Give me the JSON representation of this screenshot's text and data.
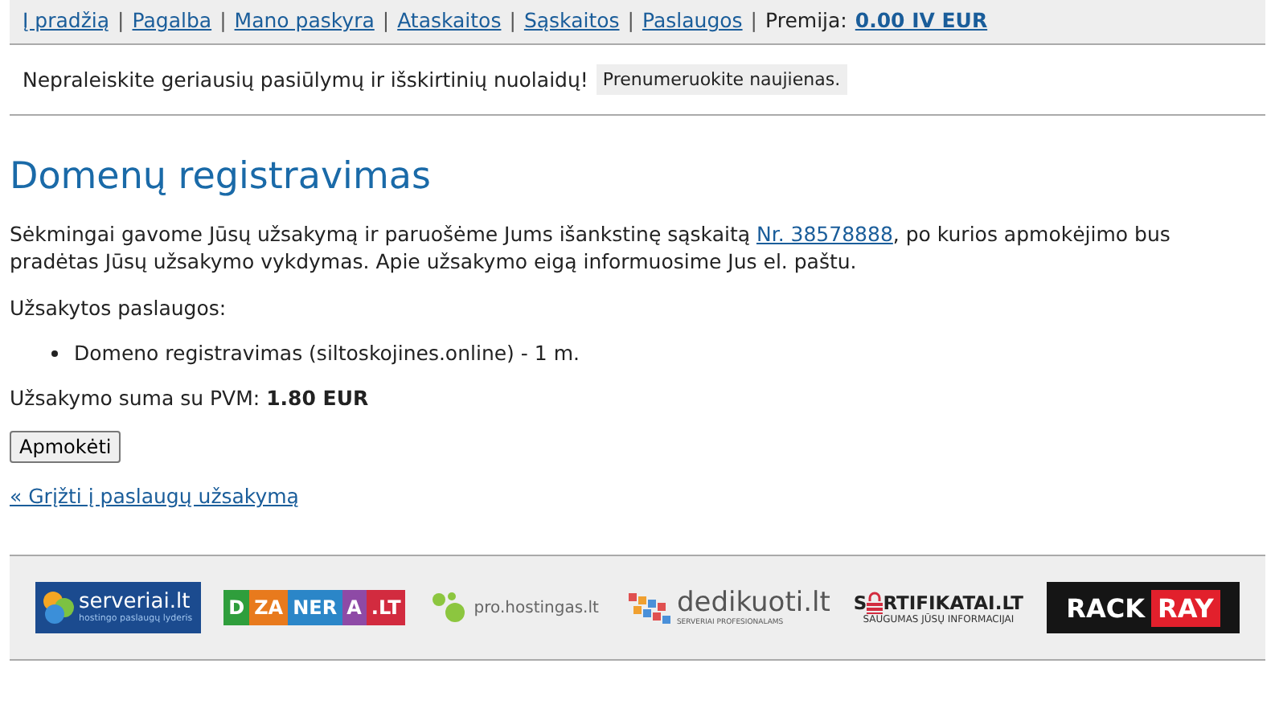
{
  "nav": {
    "links": [
      {
        "label": "Į pradžią"
      },
      {
        "label": "Pagalba"
      },
      {
        "label": "Mano paskyra"
      },
      {
        "label": "Ataskaitos"
      },
      {
        "label": "Sąskaitos"
      },
      {
        "label": "Paslaugos"
      }
    ],
    "separator": "|",
    "bonus_label": "Premija:",
    "bonus_value": "0.00 IV EUR"
  },
  "promo": {
    "text": "Nepraleiskite geriausių pasiūlymų ir išskirtinių nuolaidų!",
    "button": "Prenumeruokite naujienas."
  },
  "heading": "Domenų registravimas",
  "message": {
    "before": "Sėkmingai gavome Jūsų užsakymą ir paruošėme Jums išankstinę sąskaitą",
    "link": "Nr. 38578888",
    "after": ", po kurios apmokėjimo bus pradėtas Jūsų užsakymo vykdymas. Apie užsakymo eigą informuosime Jus el. paštu."
  },
  "services_label": "Užsakytos paslaugos:",
  "services": [
    "Domeno registravimas (siltoskojines.online) - 1 m."
  ],
  "total": "Užsakymo suma su PVM: **1.80 EUR**",
  "pay_button": "Apmokėti",
  "back_link": "« Grįžti į paslaugų užsakymą",
  "partners": [
    {
      "kind": "serveriai",
      "texts": [
        "serveriai.lt",
        "hostingo paslaugų lyderis"
      ]
    },
    {
      "kind": "dizaneria",
      "texts": [
        "D",
        "ZA",
        "NER",
        "A",
        ".LT"
      ]
    },
    {
      "kind": "prohostingas",
      "texts": [
        "pro.hostingas.lt"
      ]
    },
    {
      "kind": "dedikuoti",
      "texts": [
        "dedikuoti.lt",
        "SERVERIAI PROFESIONALAMS"
      ]
    },
    {
      "kind": "sertifikatai",
      "texts": [
        "S",
        "RTIFIKATAI.LT",
        "SAUGUMAS JŪSŲ INFORMACIJAI"
      ]
    },
    {
      "kind": "rackray",
      "texts": [
        "RACK",
        "RAY"
      ]
    }
  ]
}
